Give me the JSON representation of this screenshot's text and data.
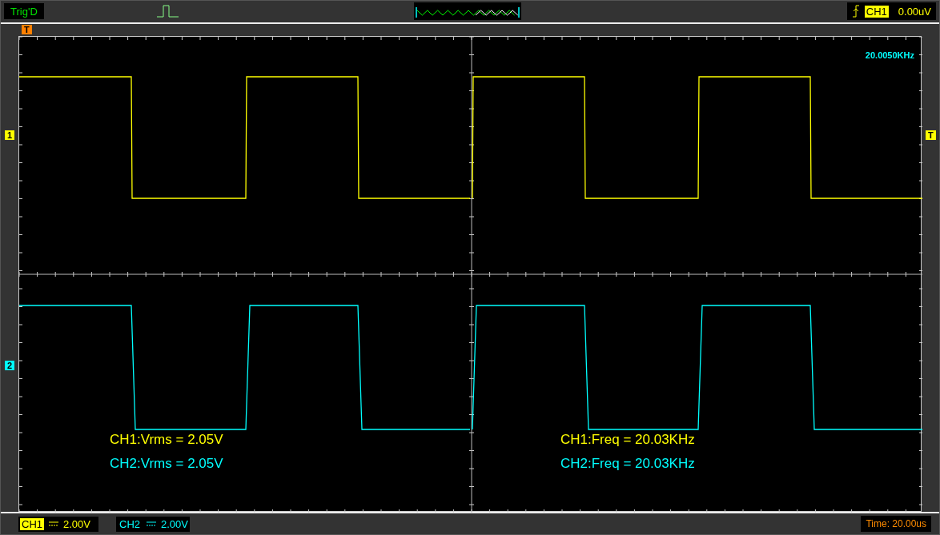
{
  "top_bar": {
    "trigger_status": "Trig'D",
    "trigger_source": "CH1",
    "trigger_level": "0.00uV"
  },
  "trigger_position_marker": "T",
  "trigger_level_marker": "T",
  "frequency_readout": "20.0050KHz",
  "channels": [
    {
      "marker": "1",
      "name": "CH1",
      "scale": "2.00V",
      "color": "#ffff00",
      "selected": true
    },
    {
      "marker": "2",
      "name": "CH2",
      "scale": "2.00V",
      "color": "#00ffff",
      "selected": false
    }
  ],
  "measurements": [
    {
      "text": "CH1:Vrms = 2.05V",
      "color": "#ffff00"
    },
    {
      "text": "CH2:Vrms = 2.05V",
      "color": "#00ffff"
    },
    {
      "text": "CH1:Freq = 20.03KHz",
      "color": "#ffff00"
    },
    {
      "text": "CH2:Freq = 20.03KHz",
      "color": "#00ffff"
    }
  ],
  "timebase": "Time: 20.00us"
}
